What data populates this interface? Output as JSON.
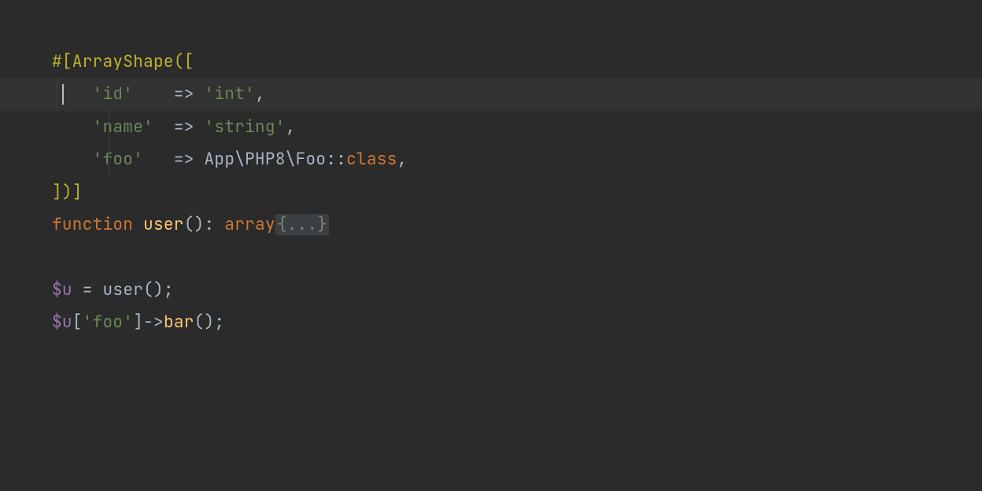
{
  "code": {
    "attr_open": "#[ArrayShape([",
    "key_id": "'id'",
    "arrow": " => ",
    "pad3": "   ",
    "pad1": " ",
    "pad2": "  ",
    "val_int": "'int'",
    "key_name": "'name'",
    "val_string": "'string'",
    "key_foo": "'foo'",
    "class_path": "App\\PHP8\\Foo",
    "dcolon": "::",
    "class_kw": "class",
    "comma": ",",
    "attr_close": "])]",
    "fn_kw": "function ",
    "fn_name": "user",
    "parens": "()",
    "colon_sp": ": ",
    "ret_type": "array",
    "folded": "{...}",
    "var_u": "$u",
    "assign": " = ",
    "call_user": "user()",
    "semi": ";",
    "bracket_open": "[",
    "bracket_close": "]",
    "idx_foo": "'foo'",
    "arrow_op": "->",
    "method_bar": "bar",
    "indent4": "    "
  }
}
